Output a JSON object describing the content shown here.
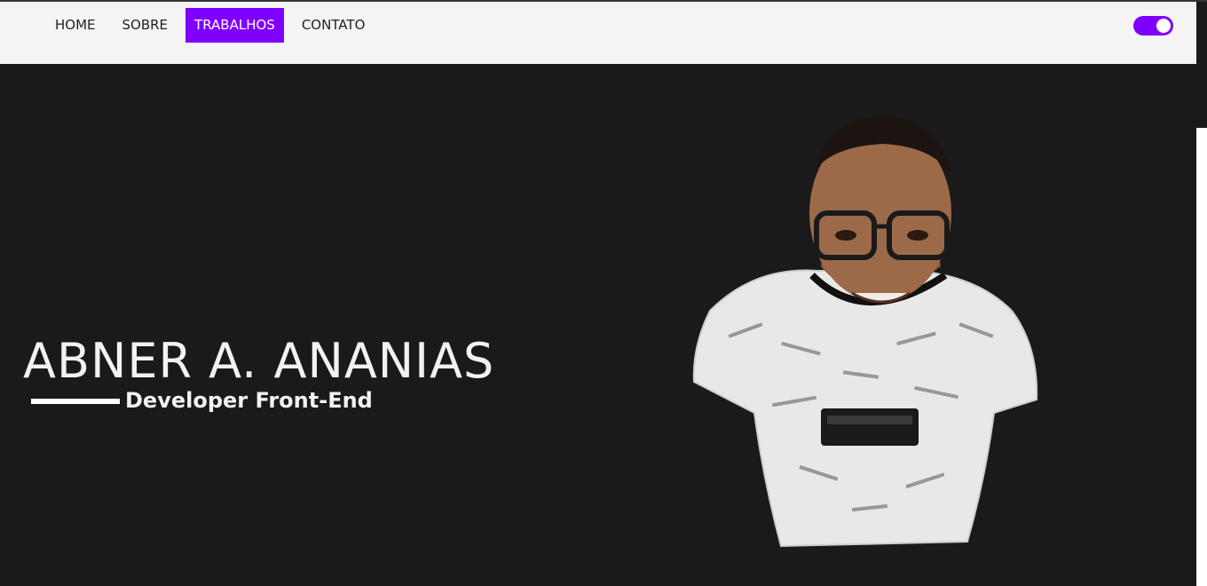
{
  "nav": {
    "items": [
      {
        "label": "HOME",
        "active": false
      },
      {
        "label": "SOBRE",
        "active": false
      },
      {
        "label": "TRABALHOS",
        "active": true
      },
      {
        "label": "CONTATO",
        "active": false
      }
    ],
    "active_color": "#8000ff"
  },
  "theme_toggle": {
    "on": true
  },
  "hero": {
    "name": "ABNER A. ANANIAS",
    "subtitle": "Developer Front-End"
  }
}
